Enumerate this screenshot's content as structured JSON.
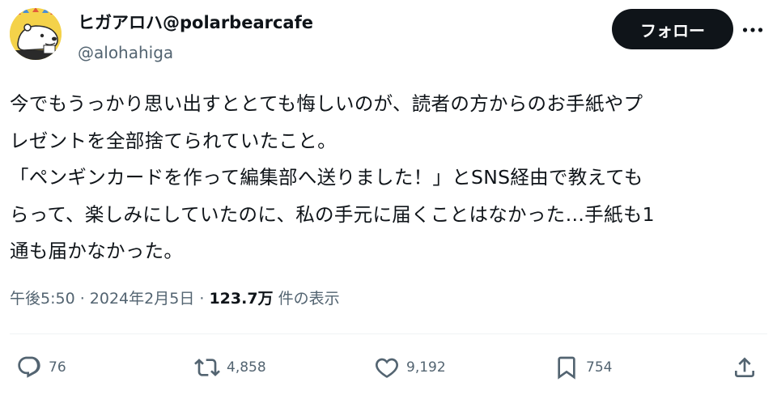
{
  "user": {
    "display_name": "ヒガアロハ@polarbearcafe",
    "handle": "@alohahiga",
    "follow_label": "フォロー"
  },
  "tweet": {
    "lines": [
      "今でもうっかり思い出すととても悔しいのが、読者の方からのお手紙やプ",
      "レゼントを全部捨てられていたこと。",
      "「ペンギンカードを作って編集部へ送りました！」とSNS経由で教えても",
      "らって、楽しみにしていたのに、私の手元に届くことはなかった…手紙も1",
      "通も届かなかった。"
    ]
  },
  "meta": {
    "time": "午後5:50",
    "separator": " · ",
    "date": "2024年2月5日",
    "views_count": "123.7万",
    "views_label": " 件の表示"
  },
  "actions": {
    "replies": "76",
    "reposts": "4,858",
    "likes": "9,192",
    "bookmarks": "754"
  },
  "colors": {
    "text": "#0f1419",
    "secondary": "#536471",
    "button_bg": "#0f1419",
    "avatar_bg": "#f4d24a"
  }
}
